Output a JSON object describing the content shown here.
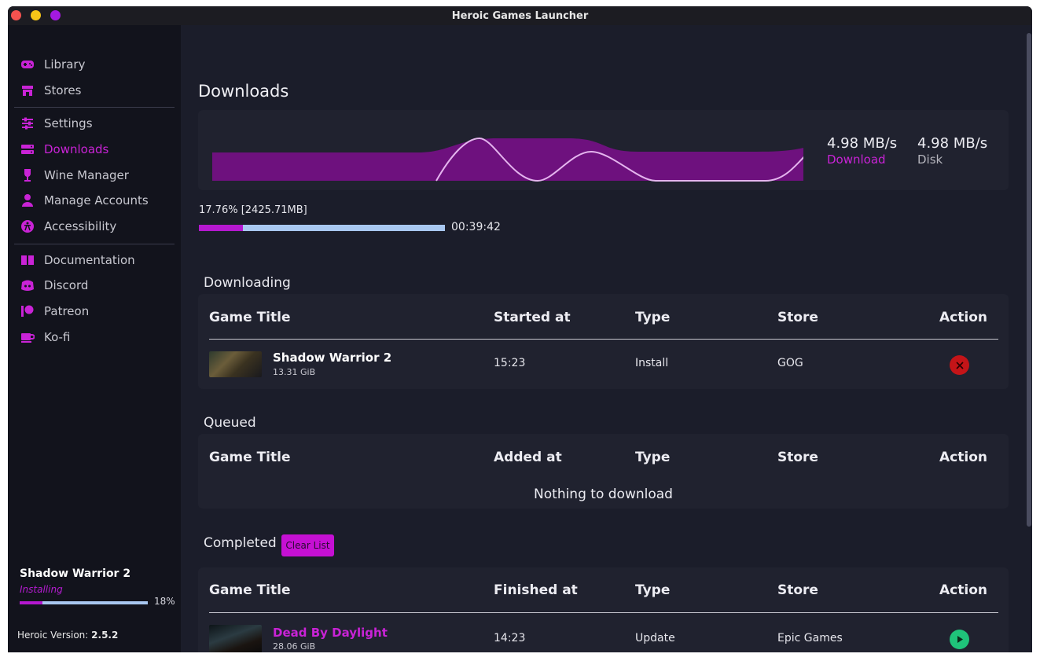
{
  "window": {
    "title": "Heroic Games Launcher",
    "controls": [
      {
        "name": "close",
        "color": "#f5524f"
      },
      {
        "name": "minimize",
        "color": "#f5c518"
      },
      {
        "name": "maximize",
        "color": "#a419e0"
      }
    ]
  },
  "sidebar": {
    "items": [
      {
        "label": "Library",
        "icon": "gamepad-icon"
      },
      {
        "label": "Stores",
        "icon": "store-icon"
      },
      {
        "label": "Settings",
        "icon": "sliders-icon"
      },
      {
        "label": "Downloads",
        "icon": "hard-drive-icon",
        "active": true
      },
      {
        "label": "Wine Manager",
        "icon": "wine-glass-icon"
      },
      {
        "label": "Manage Accounts",
        "icon": "user-icon"
      },
      {
        "label": "Accessibility",
        "icon": "accessibility-icon"
      },
      {
        "label": "Documentation",
        "icon": "book-icon"
      },
      {
        "label": "Discord",
        "icon": "discord-icon"
      },
      {
        "label": "Patreon",
        "icon": "patreon-icon"
      },
      {
        "label": "Ko-fi",
        "icon": "coffee-cup-icon"
      }
    ],
    "current_download": {
      "title": "Shadow Warrior 2",
      "status": "Installing",
      "progress": 0.18,
      "percent_label": "18%"
    },
    "version_label": "Heroic Version:",
    "version_value": "2.5.2"
  },
  "main": {
    "title": "Downloads",
    "stats": {
      "download_value": "4.98 MB/s",
      "download_label": "Download",
      "disk_value": "4.98 MB/s",
      "disk_label": "Disk"
    },
    "progress": {
      "text": "17.76% [2425.71MB]",
      "fraction": 0.1776,
      "eta": "00:39:42"
    },
    "downloading": {
      "section_title": "Downloading",
      "headers": {
        "title": "Game Title",
        "time": "Started at",
        "type": "Type",
        "store": "Store",
        "action": "Action"
      },
      "rows": [
        {
          "title": "Shadow Warrior 2",
          "size": "13.31 GiB",
          "time": "15:23",
          "type": "Install",
          "store": "GOG",
          "action_icon": "cancel-x-icon"
        }
      ]
    },
    "queued": {
      "section_title": "Queued",
      "headers": {
        "title": "Game Title",
        "time": "Added at",
        "type": "Type",
        "store": "Store",
        "action": "Action"
      },
      "empty_text": "Nothing to download"
    },
    "completed": {
      "section_title": "Completed",
      "clear_label": "Clear List",
      "headers": {
        "title": "Game Title",
        "time": "Finished at",
        "type": "Type",
        "store": "Store",
        "action": "Action"
      },
      "rows": [
        {
          "title": "Dead By Daylight",
          "size": "28.06 GiB",
          "time": "14:23",
          "type": "Update",
          "store": "Epic Games",
          "action_icon": "play-icon"
        }
      ]
    }
  },
  "colors": {
    "accent": "#b518d0",
    "progress_track": "#a8c7f0",
    "cancel": "#c41418",
    "play": "#1fc37a"
  }
}
